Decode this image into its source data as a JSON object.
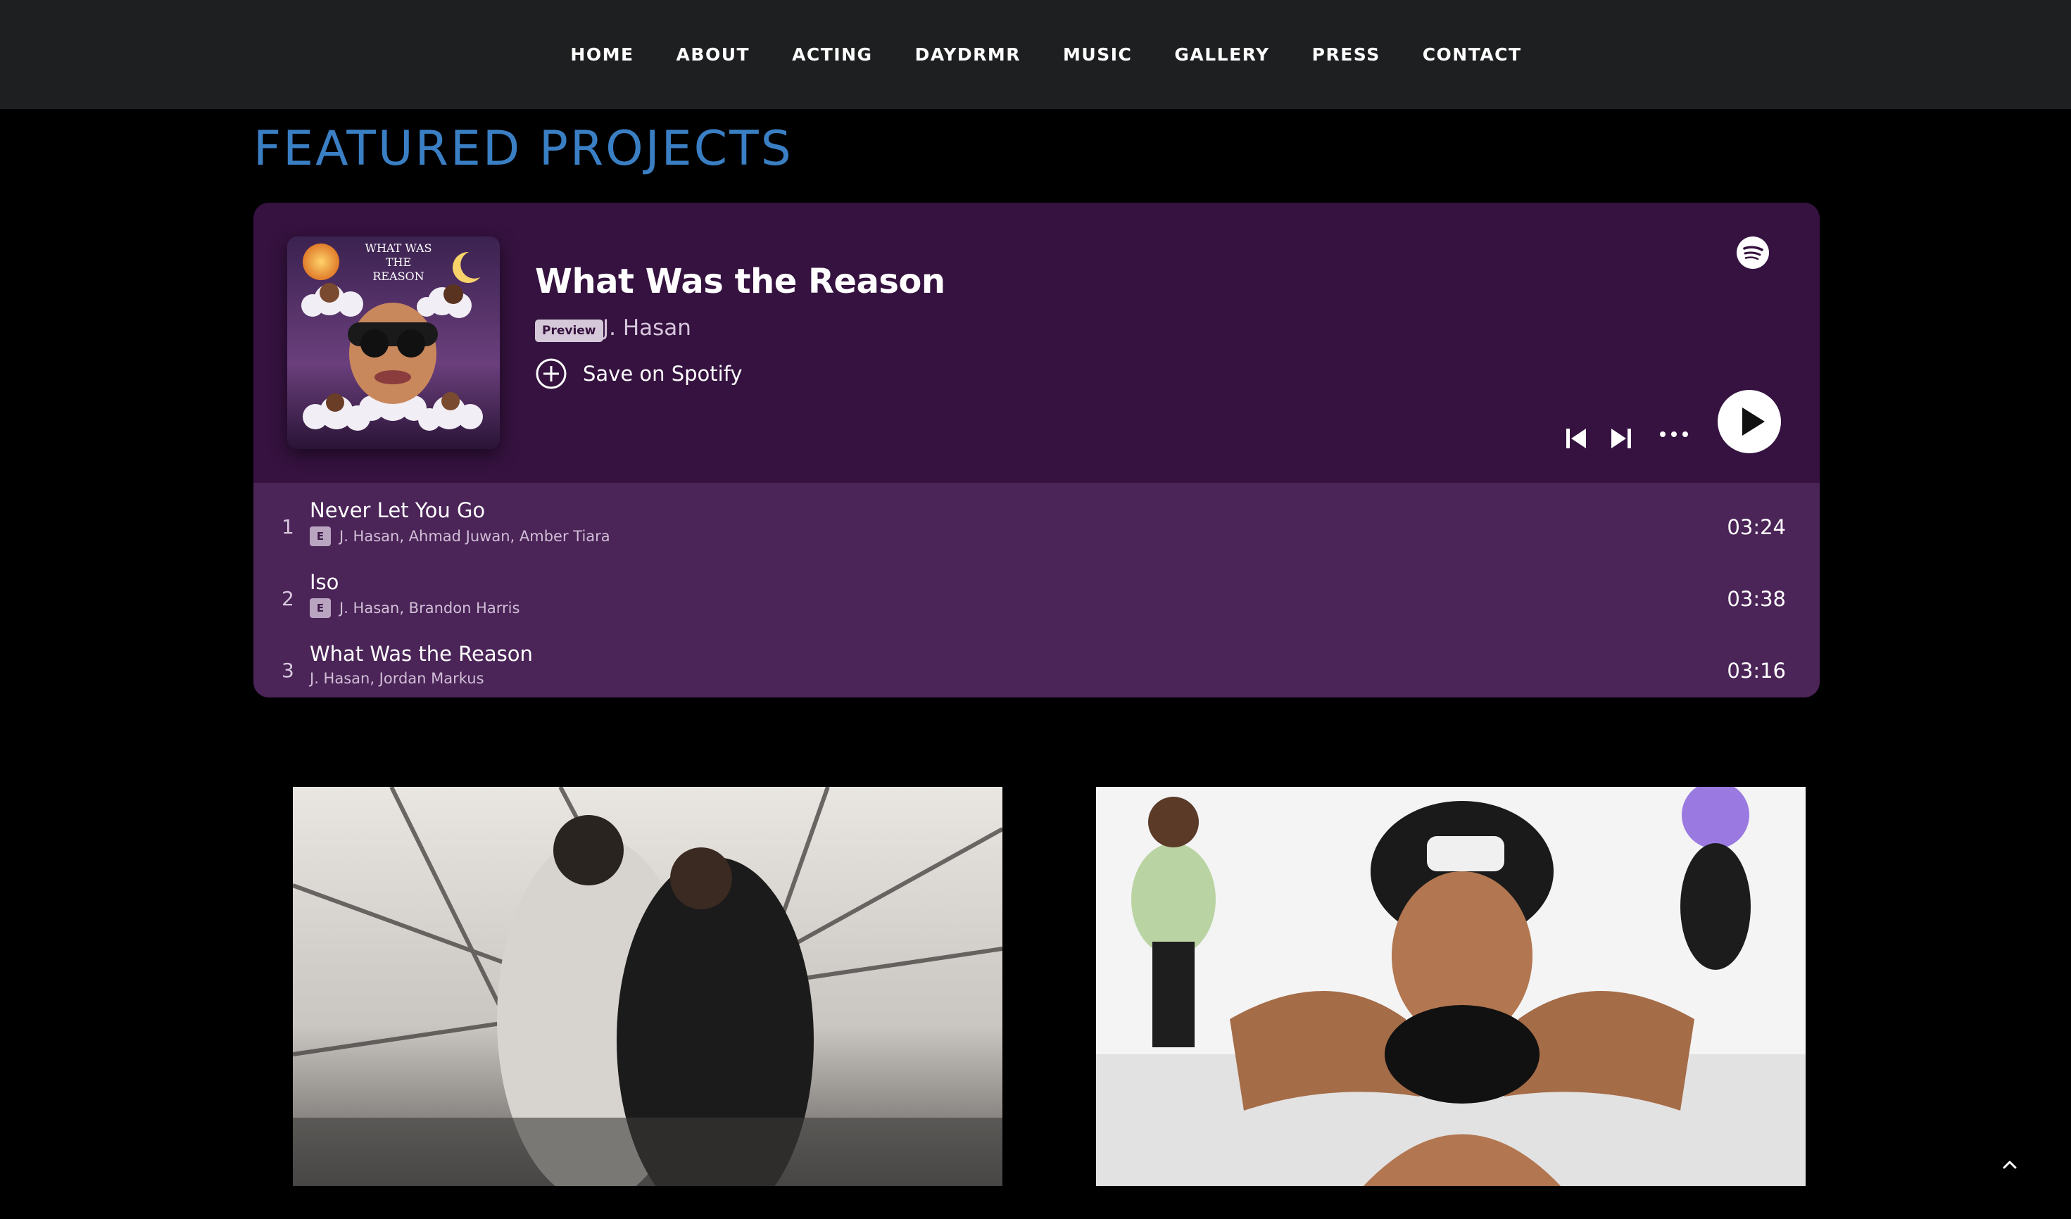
{
  "nav": {
    "items": [
      "HOME",
      "ABOUT",
      "ACTING",
      "DAYDRMR",
      "MUSIC",
      "GALLERY",
      "PRESS",
      "CONTACT"
    ]
  },
  "section": {
    "title": "FEATURED PROJECTS"
  },
  "player": {
    "title": "What Was the Reason",
    "badge": "Preview",
    "artist": "J. Hasan",
    "save_label": "Save on Spotify",
    "cover_text": "WHAT WAS THE REASON",
    "tracks": [
      {
        "num": "1",
        "name": "Never Let You Go",
        "explicit": "E",
        "artists": "J. Hasan, Ahmad Juwan, Amber Tiara",
        "duration": "03:24"
      },
      {
        "num": "2",
        "name": "Iso",
        "explicit": "E",
        "artists": "J. Hasan, Brandon Harris",
        "duration": "03:38"
      },
      {
        "num": "3",
        "name": "What Was the Reason",
        "explicit": "",
        "artists": "J. Hasan, Jordan Markus",
        "duration": "03:16"
      }
    ]
  },
  "colors": {
    "nav_bg": "#1e1f20",
    "heading": "#3a7fc4",
    "embed_top": "#35123f",
    "embed_list": "#4b2458"
  },
  "icons": [
    "spotify-icon",
    "add-circle-icon",
    "skip-previous-icon",
    "skip-next-icon",
    "more-icon",
    "play-icon",
    "chevron-up-icon"
  ]
}
